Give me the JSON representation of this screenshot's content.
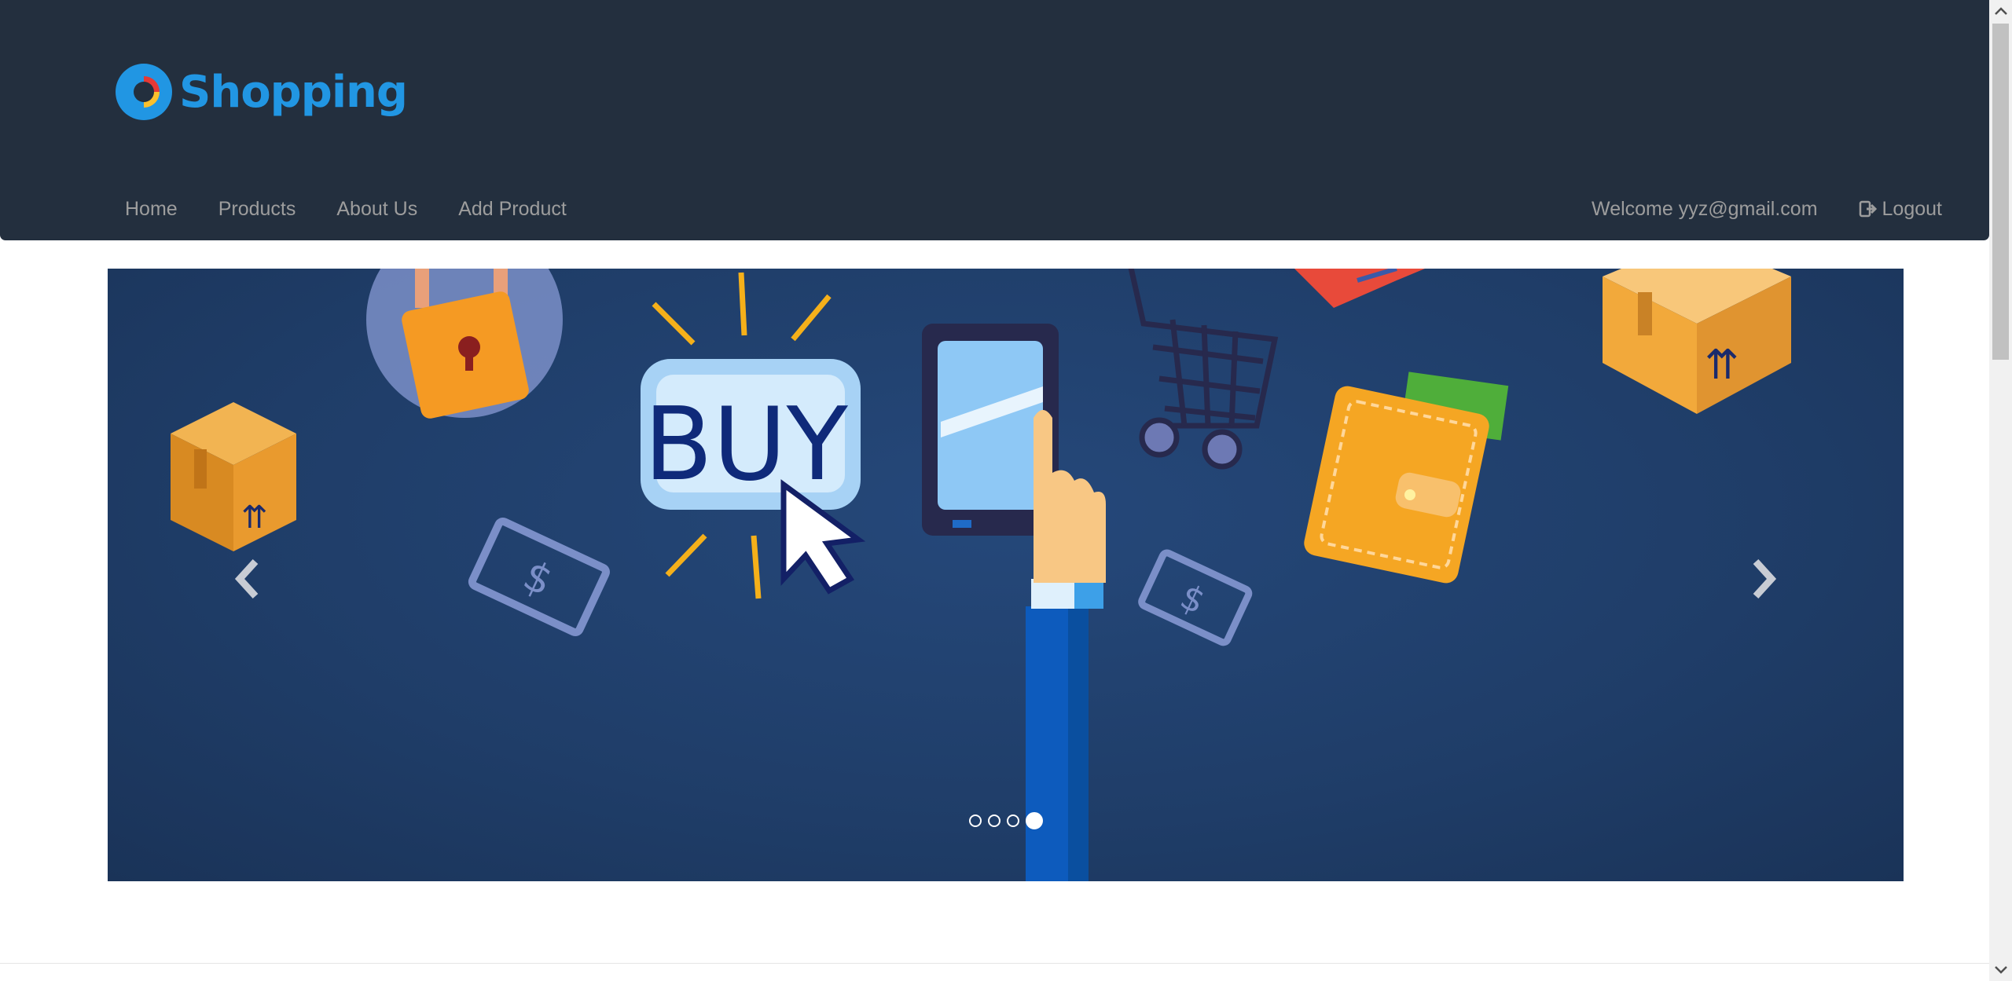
{
  "brand": {
    "name": "Shopping",
    "logo_icon": "shopping-logo-icon",
    "color": "#2196e3"
  },
  "nav": {
    "left_items": [
      {
        "label": "Home"
      },
      {
        "label": "Products"
      },
      {
        "label": "About Us"
      },
      {
        "label": "Add Product"
      }
    ],
    "welcome_text": "Welcome yyz@gmail.com",
    "logout_label": "Logout",
    "logout_icon": "logout-icon"
  },
  "carousel": {
    "image": "online-shopping-banner",
    "buy_text": "BUY",
    "slides_count": 4,
    "active_index": 4,
    "prev_icon": "chevron-left-icon",
    "next_icon": "chevron-right-icon"
  },
  "colors": {
    "navbar_bg": "#232f3e",
    "nav_link": "#9d9d9d",
    "banner_bg": "#1f3d68"
  }
}
